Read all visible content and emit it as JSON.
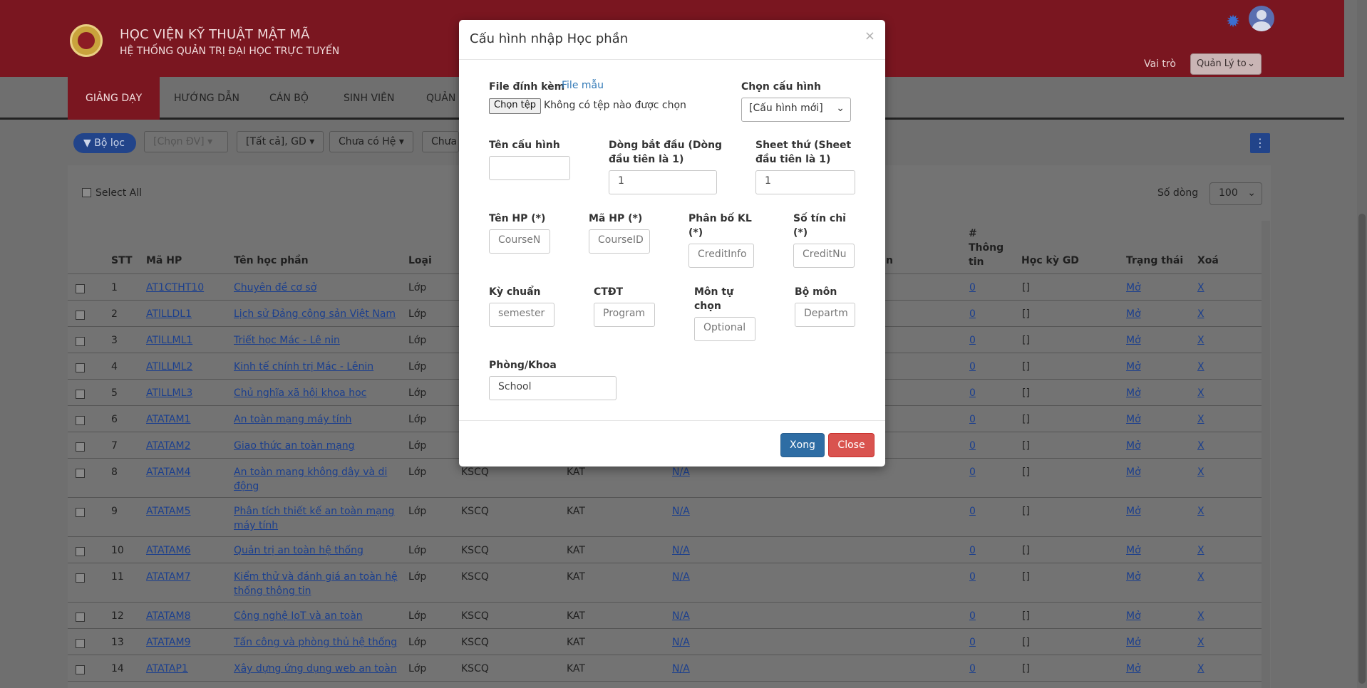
{
  "header": {
    "org_name": "HỌC VIỆN KỸ THUẬT MẬT MÃ",
    "org_sub": "HỆ THỐNG QUẢN TRỊ ĐẠI HỌC TRỰC TUYẾN",
    "role_label": "Vai trò",
    "role_value": "Quản Lý to"
  },
  "nav": {
    "items": [
      "GIẢNG DẠY",
      "HƯỚNG DẪN",
      "CÁN BỘ",
      "SINH VIÊN",
      "QUẢN"
    ]
  },
  "filters": {
    "toggle": "Bộ lọc",
    "dv": "[Chọn ĐV]",
    "all": "[Tất cả], GD",
    "he": "Chưa có Hệ",
    "more": "Chưa",
    "menu": "⋮"
  },
  "table": {
    "select_all": "Select All",
    "rows_label": "Số dòng",
    "rows_value": "100",
    "headers": {
      "stt": "STT",
      "ma_hp": "Mã HP",
      "ten_hp": "Tên học phần",
      "loai": "Loại",
      "hidden": "n",
      "thong_tin": "# Thông tin",
      "hoc_ky": "Học kỳ GD",
      "trang_thai": "Trạng thái",
      "xoa": "Xoá"
    },
    "rows": [
      {
        "stt": "1",
        "ma": "AT1CTHT10",
        "ten": "Chuyên đề cơ sở",
        "loai": "Lớp",
        "c1": "",
        "c2": "",
        "c3": "",
        "info": "0",
        "hk": "[]",
        "tt": "Mở",
        "xoa": "X"
      },
      {
        "stt": "2",
        "ma": "ATlLLDL1",
        "ten": "Lịch sử Đảng cộng sản Việt Nam",
        "loai": "Lớp",
        "c1": "",
        "c2": "",
        "c3": "",
        "info": "0",
        "hk": "[]",
        "tt": "Mở",
        "xoa": "X"
      },
      {
        "stt": "3",
        "ma": "ATlLLML1",
        "ten": "Triết học Mác - Lê nin",
        "loai": "Lớp",
        "c1": "",
        "c2": "",
        "c3": "",
        "info": "0",
        "hk": "[]",
        "tt": "Mở",
        "xoa": "X"
      },
      {
        "stt": "4",
        "ma": "ATlLLML2",
        "ten": "Kinh tế chính trị Mác - Lênin",
        "loai": "Lớp",
        "c1": "",
        "c2": "",
        "c3": "",
        "info": "0",
        "hk": "[]",
        "tt": "Mở",
        "xoa": "X"
      },
      {
        "stt": "5",
        "ma": "ATlLLML3",
        "ten": "Chủ nghĩa xã hội khoa học",
        "loai": "Lớp",
        "c1": "",
        "c2": "",
        "c3": "",
        "info": "0",
        "hk": "[]",
        "tt": "Mở",
        "xoa": "X"
      },
      {
        "stt": "6",
        "ma": "ATATAM1",
        "ten": "An toàn mạng máy tính",
        "loai": "Lớp",
        "c1": "",
        "c2": "",
        "c3": "",
        "info": "0",
        "hk": "[]",
        "tt": "Mở",
        "xoa": "X"
      },
      {
        "stt": "7",
        "ma": "ATATAM2",
        "ten": "Giao thức an toàn mạng",
        "loai": "Lớp",
        "c1": "",
        "c2": "",
        "c3": "",
        "info": "0",
        "hk": "[]",
        "tt": "Mở",
        "xoa": "X"
      },
      {
        "stt": "8",
        "ma": "ATATAM4",
        "ten": "An toàn mạng không dây và di",
        "ten2": "động",
        "loai": "Lớp",
        "c1": "KSCQ",
        "c2": "KAT",
        "c3": "N/A",
        "info": "0",
        "hk": "[]",
        "tt": "Mở",
        "xoa": "X"
      },
      {
        "stt": "9",
        "ma": "ATATAM5",
        "ten": "Phân tích thiết kế an toàn mạng",
        "ten2": "máy tính",
        "loai": "Lớp",
        "c1": "KSCQ",
        "c2": "KAT",
        "c3": "N/A",
        "info": "0",
        "hk": "[]",
        "tt": "Mở",
        "xoa": "X"
      },
      {
        "stt": "10",
        "ma": "ATATAM6",
        "ten": "Quản trị an toàn hệ thống",
        "loai": "Lớp",
        "c1": "KSCQ",
        "c2": "KAT",
        "c3": "N/A",
        "info": "0",
        "hk": "[]",
        "tt": "Mở",
        "xoa": "X"
      },
      {
        "stt": "11",
        "ma": "ATATAM7",
        "ten": "Kiểm thử và đánh giá an toàn hệ",
        "ten2": "thống thông tin",
        "loai": "Lớp",
        "c1": "KSCQ",
        "c2": "KAT",
        "c3": "N/A",
        "info": "0",
        "hk": "[]",
        "tt": "Mở",
        "xoa": "X"
      },
      {
        "stt": "12",
        "ma": "ATATAM8",
        "ten": "Công nghệ IoT và an toàn",
        "loai": "Lớp",
        "c1": "KSCQ",
        "c2": "KAT",
        "c3": "N/A",
        "info": "0",
        "hk": "[]",
        "tt": "Mở",
        "xoa": "X"
      },
      {
        "stt": "13",
        "ma": "ATATAM9",
        "ten": "Tấn công và phòng thủ hệ thống",
        "loai": "Lớp",
        "c1": "KSCQ",
        "c2": "KAT",
        "c3": "N/A",
        "info": "0",
        "hk": "[]",
        "tt": "Mở",
        "xoa": "X"
      },
      {
        "stt": "14",
        "ma": "ATATAP1",
        "ten": "Xây dựng ứng dụng web an toàn",
        "loai": "Lớp",
        "c1": "KSCQ",
        "c2": "KAT",
        "c3": "N/A",
        "info": "0",
        "hk": "[]",
        "tt": "Mở",
        "xoa": "X"
      }
    ]
  },
  "modal": {
    "title": "Cấu hình nhập Học phần",
    "close_icon": "×",
    "file_label": "File đính kèm",
    "file_link": "File mẫu",
    "file_button": "Chọn tệp",
    "file_status": "Không có tệp nào được chọn",
    "config_label": "Chọn cấu hình",
    "config_value": "[Cấu hình mới]",
    "name_label": "Tên cấu hình",
    "name_value": "",
    "start_row_label": "Dòng bắt đầu (Dòng đầu tiên là 1)",
    "start_row_value": "1",
    "sheet_label": "Sheet thứ (Sheet đầu tiên là 1)",
    "sheet_value": "1",
    "ten_hp_label": "Tên HP (*)",
    "ten_hp_ph": "CourseN",
    "ma_hp_label": "Mã HP (*)",
    "ma_hp_ph": "CourseID",
    "phan_bo_label": "Phân bố KL (*)",
    "phan_bo_ph": "CreditInfo",
    "so_tin_chi_label": "Số tín chỉ (*)",
    "so_tin_chi_ph": "CreditNu",
    "ky_chuan_label": "Kỳ chuẩn",
    "ky_chuan_ph": "semester",
    "ctdt_label": "CTĐT",
    "ctdt_ph": "Program",
    "mon_tu_chon_label": "Môn tự chọn",
    "mon_tu_chon_ph": "Optional",
    "bo_mon_label": "Bộ môn",
    "bo_mon_ph": "Departm",
    "phong_khoa_label": "Phòng/Khoa",
    "phong_khoa_value": "School",
    "ok_button": "Xong",
    "close_button": "Close"
  }
}
